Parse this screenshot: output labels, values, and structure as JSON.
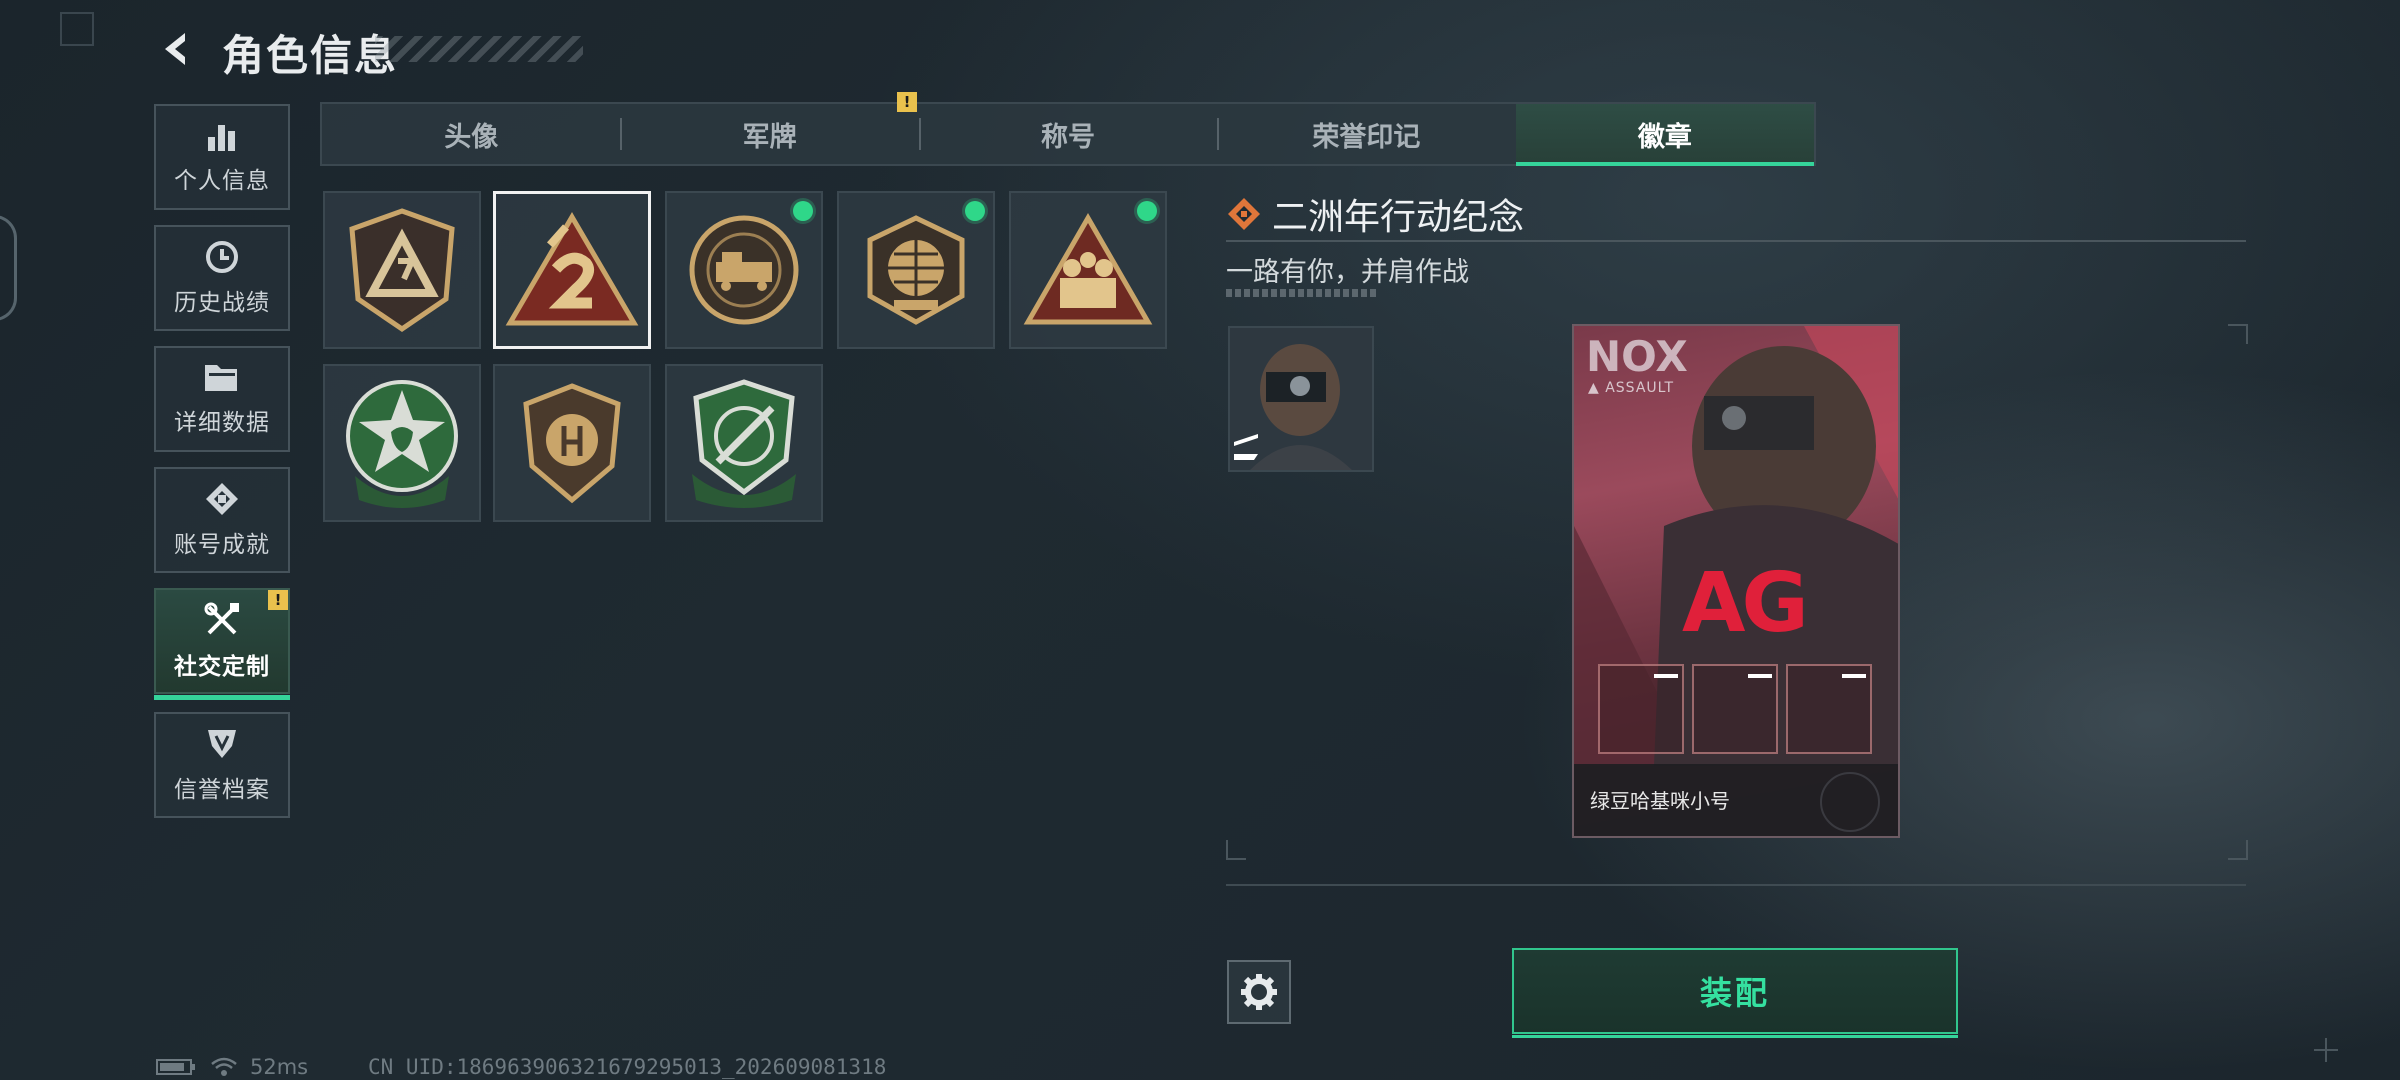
{
  "header": {
    "title": "角色信息"
  },
  "sidebar": {
    "items": [
      {
        "label": "个人信息",
        "icon": "bar-chart-icon"
      },
      {
        "label": "历史战绩",
        "icon": "clock-icon"
      },
      {
        "label": "详细数据",
        "icon": "folder-icon"
      },
      {
        "label": "账号成就",
        "icon": "achievement-icon"
      },
      {
        "label": "社交定制",
        "icon": "tools-icon",
        "active": true,
        "alert": "!"
      },
      {
        "label": "信誉档案",
        "icon": "shield-icon"
      }
    ]
  },
  "tabs": [
    {
      "label": "头像"
    },
    {
      "label": "军牌",
      "alert": "!"
    },
    {
      "label": "称号"
    },
    {
      "label": "荣誉印记"
    },
    {
      "label": "徽章",
      "active": true
    }
  ],
  "badges": [
    {
      "name": "triangle-a-badge",
      "new": false
    },
    {
      "name": "number-2-badge",
      "selected": true,
      "new": false
    },
    {
      "name": "delta-force-2026-train-badge",
      "new": true
    },
    {
      "name": "delta-force-2026-globe-badge",
      "new": true
    },
    {
      "name": "soldiers-triangle-badge",
      "new": true
    },
    {
      "name": "green-star-alien-badge",
      "new": false
    },
    {
      "name": "bronze-shield-badge",
      "new": false
    },
    {
      "name": "green-knife-shield-badge",
      "new": false
    }
  ],
  "detail": {
    "title": "二洲年行动纪念",
    "subtitle": "一路有你，并肩作战"
  },
  "card": {
    "brand": "NOX",
    "role": "ASSAULT",
    "logo": "AG",
    "player_name": "绿豆哈基咪小号"
  },
  "actions": {
    "equip_label": "装配"
  },
  "status": {
    "ping": "52ms",
    "uid": "CN UID:1869639063216792950​13_202609081318"
  },
  "colors": {
    "accent": "#35d49a",
    "alert": "#e9c14d",
    "orange": "#e0763a"
  }
}
